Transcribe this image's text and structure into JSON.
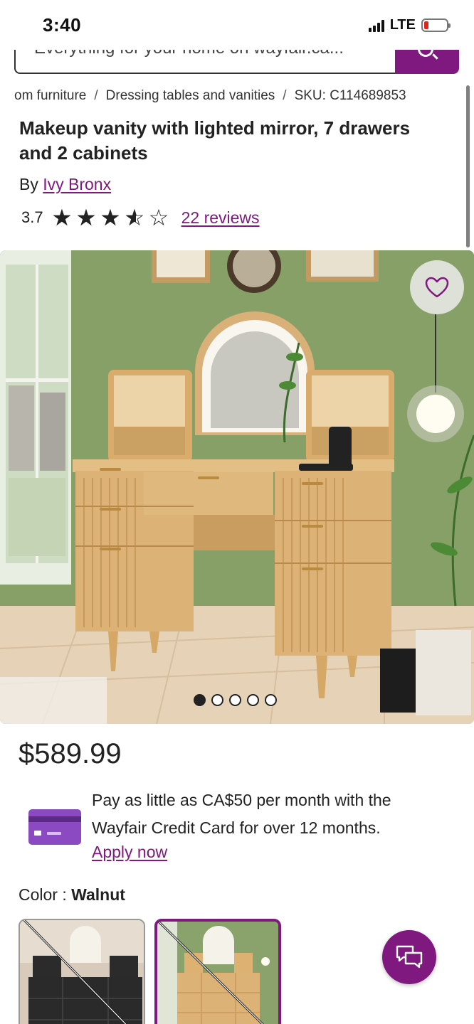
{
  "status_bar": {
    "time": "3:40",
    "network": "LTE",
    "battery_level": "low",
    "battery_color": "#e2231a"
  },
  "search": {
    "placeholder": "Everything for your home on wayfair.ca..."
  },
  "breadcrumb": {
    "items": [
      "om furniture",
      "Dressing tables and vanities",
      "SKU: C114689853"
    ],
    "separator": "/"
  },
  "product": {
    "title": "Makeup vanity with lighted mirror, 7 drawers and 2 cabinets",
    "by_label": "By",
    "brand": "Ivy Bronx",
    "rating": "3.7",
    "rating_value": 3.7,
    "rating_max": 5,
    "reviews": "22 reviews",
    "price": "$589.99"
  },
  "gallery": {
    "image_count": 5,
    "active_index": 0,
    "wishlist_icon": "heart-icon"
  },
  "financing": {
    "text": "Pay as little as CA$50 per month with the Wayfair Credit Card for over 12 months.",
    "apply_label": "Apply now",
    "icon": "credit-card-icon"
  },
  "color": {
    "label": "Color :",
    "selected": "Walnut",
    "options": [
      "black",
      "walnut"
    ],
    "selected_index": 1
  },
  "chat": {
    "icon": "chat-bubbles-icon"
  },
  "theme": {
    "accent": "#7f187f",
    "text": "#222222"
  }
}
